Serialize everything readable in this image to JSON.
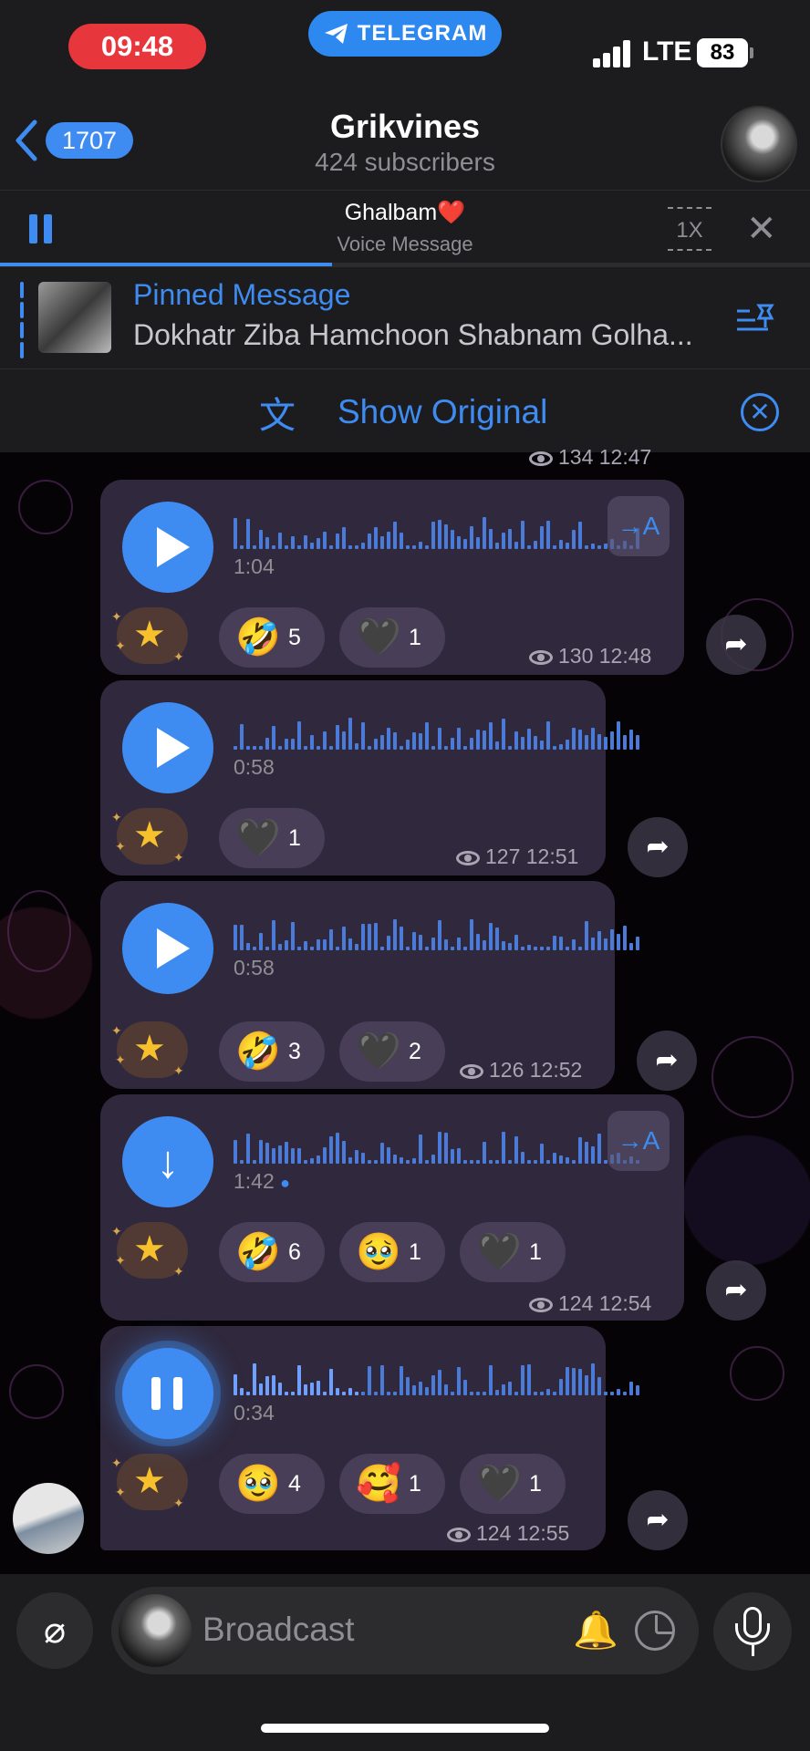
{
  "status": {
    "time": "09:48",
    "app": "TELEGRAM",
    "network": "LTE",
    "battery": "83"
  },
  "header": {
    "back_count": "1707",
    "title": "Grikvines",
    "subtitle": "424 subscribers"
  },
  "player": {
    "title": "Ghalbam❤️",
    "subtitle": "Voice Message",
    "speed": "1X",
    "progress": 0.41
  },
  "pinned": {
    "title": "Pinned Message",
    "text": "Dokhatr Ziba Hamchoon Shabnam Golha..."
  },
  "translate": {
    "label": "Show Original"
  },
  "prev_meta": {
    "views": "134",
    "time": "12:47"
  },
  "messages": [
    {
      "duration": "1:04",
      "views": "130",
      "time": "12:48",
      "translate": "→A",
      "reactions": [
        {
          "emoji": "🤣",
          "count": "5"
        },
        {
          "emoji": "🖤",
          "count": "1"
        }
      ]
    },
    {
      "duration": "0:58",
      "views": "127",
      "time": "12:51",
      "reactions": [
        {
          "emoji": "🖤",
          "count": "1"
        }
      ]
    },
    {
      "duration": "0:58",
      "views": "126",
      "time": "12:52",
      "reactions": [
        {
          "emoji": "🤣",
          "count": "3"
        },
        {
          "emoji": "🖤",
          "count": "2"
        }
      ]
    },
    {
      "duration": "1:42",
      "views": "124",
      "time": "12:54",
      "translate": "→A",
      "reactions": [
        {
          "emoji": "🤣",
          "count": "6"
        },
        {
          "emoji": "🥹",
          "count": "1"
        },
        {
          "emoji": "🖤",
          "count": "1"
        }
      ]
    },
    {
      "duration": "0:34",
      "views": "124",
      "time": "12:55",
      "reactions": [
        {
          "emoji": "🥹",
          "count": "4"
        },
        {
          "emoji": "🥰",
          "count": "1"
        },
        {
          "emoji": "🖤",
          "count": "1"
        }
      ]
    }
  ],
  "input": {
    "placeholder": "Broadcast"
  },
  "colors": {
    "accent": "#3e8cf1",
    "live_pill": "#e8363d",
    "bubble": "#342c42"
  }
}
